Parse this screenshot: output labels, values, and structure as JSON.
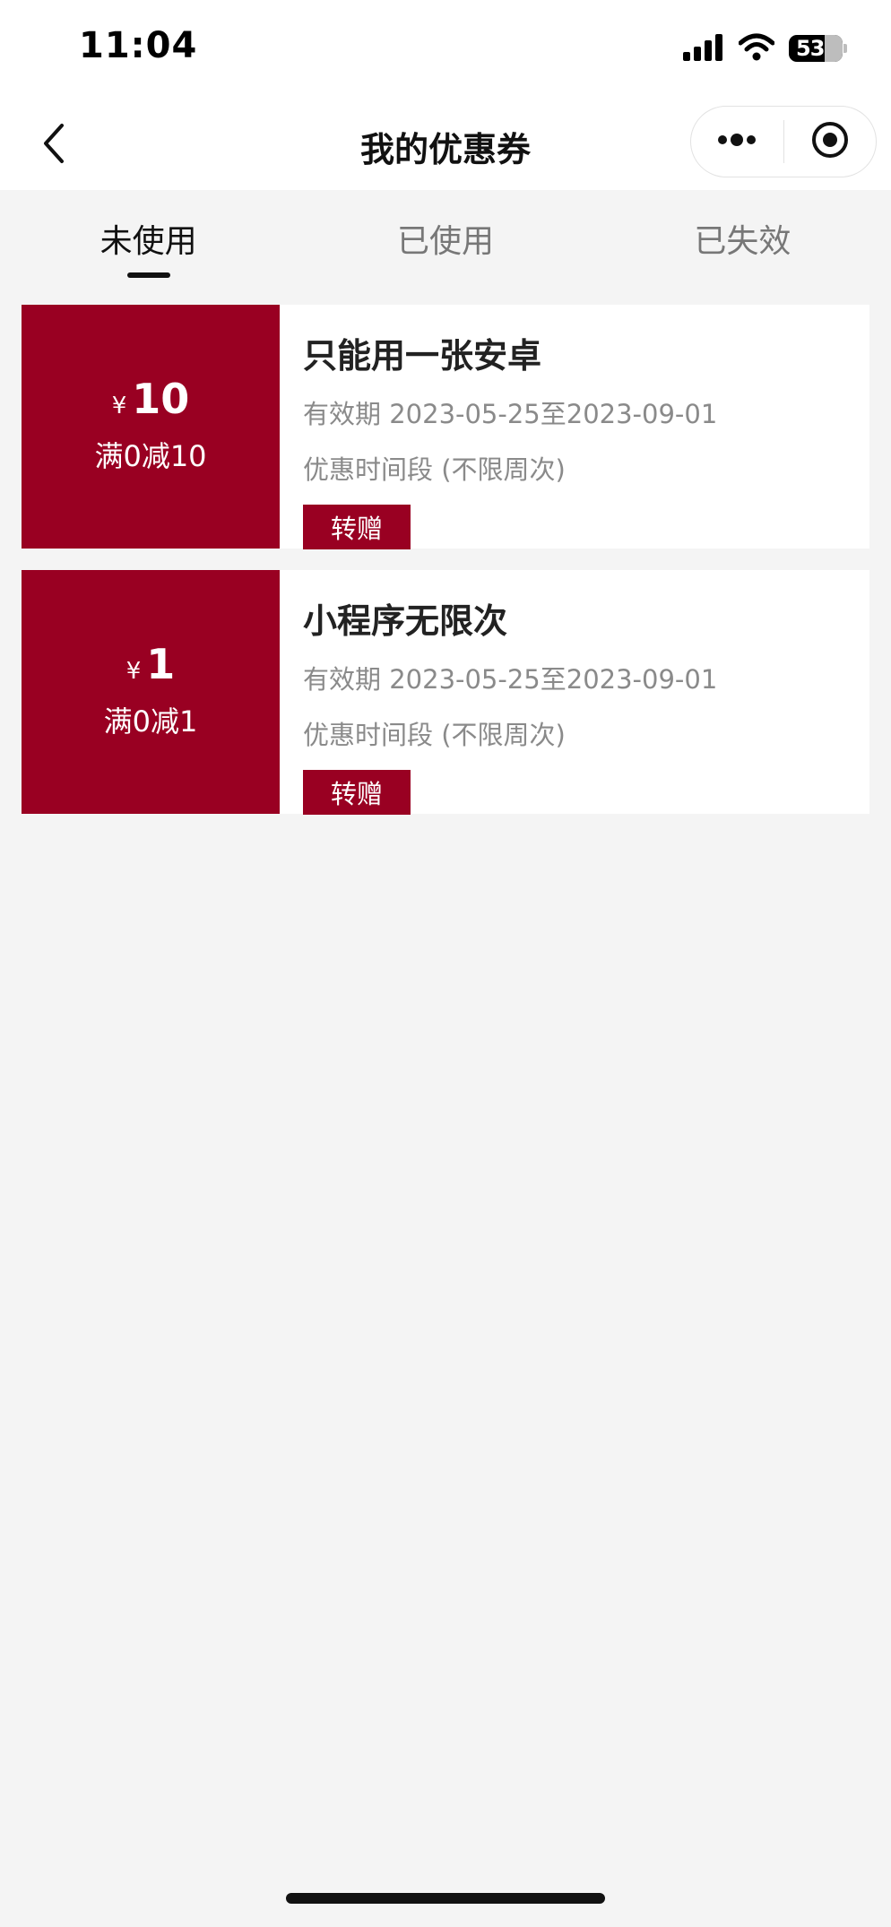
{
  "status_bar": {
    "time": "11:04",
    "battery_level": "53"
  },
  "nav": {
    "title": "我的优惠券",
    "back_icon": "chevron-left-icon",
    "more_icon": "more-dots-icon",
    "close_icon": "target-circle-icon"
  },
  "tabs": [
    {
      "label": "未使用",
      "active": true
    },
    {
      "label": "已使用",
      "active": false
    },
    {
      "label": "已失效",
      "active": false
    }
  ],
  "coupons": [
    {
      "currency": "¥",
      "amount": "10",
      "condition": "满0减10",
      "name": "只能用一张安卓",
      "validity": "有效期 2023-05-25至2023-09-01",
      "timeslot": "优惠时间段 (不限周次)",
      "gift_label": "转赠"
    },
    {
      "currency": "¥",
      "amount": "1",
      "condition": "满0减1",
      "name": "小程序无限次",
      "validity": "有效期 2023-05-25至2023-09-01",
      "timeslot": "优惠时间段 (不限周次)",
      "gift_label": "转赠"
    }
  ],
  "colors": {
    "accent": "#990022",
    "background": "#f4f4f4"
  }
}
